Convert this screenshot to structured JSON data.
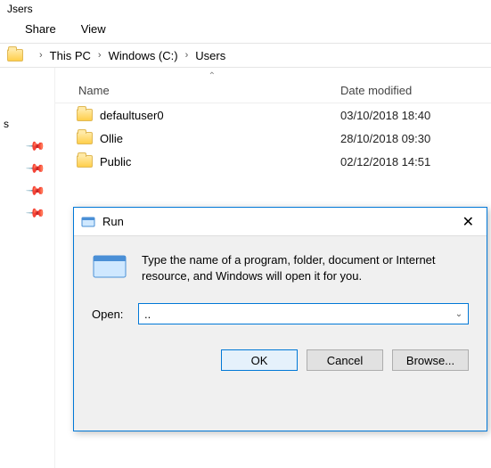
{
  "window": {
    "title": "Jsers"
  },
  "menu": {
    "share": "Share",
    "view": "View"
  },
  "breadcrumb": {
    "pc": "This PC",
    "drive": "Windows (C:)",
    "folder": "Users"
  },
  "columns": {
    "name": "Name",
    "date": "Date modified"
  },
  "rows": [
    {
      "name": "defaultuser0",
      "date": "03/10/2018 18:40"
    },
    {
      "name": "Ollie",
      "date": "28/10/2018 09:30"
    },
    {
      "name": "Public",
      "date": "02/12/2018 14:51"
    }
  ],
  "dialog": {
    "title": "Run",
    "description": "Type the name of a program, folder, document or Internet resource, and Windows will open it for you.",
    "open_label": "Open:",
    "value": "..",
    "ok": "OK",
    "cancel": "Cancel",
    "browse": "Browse..."
  }
}
